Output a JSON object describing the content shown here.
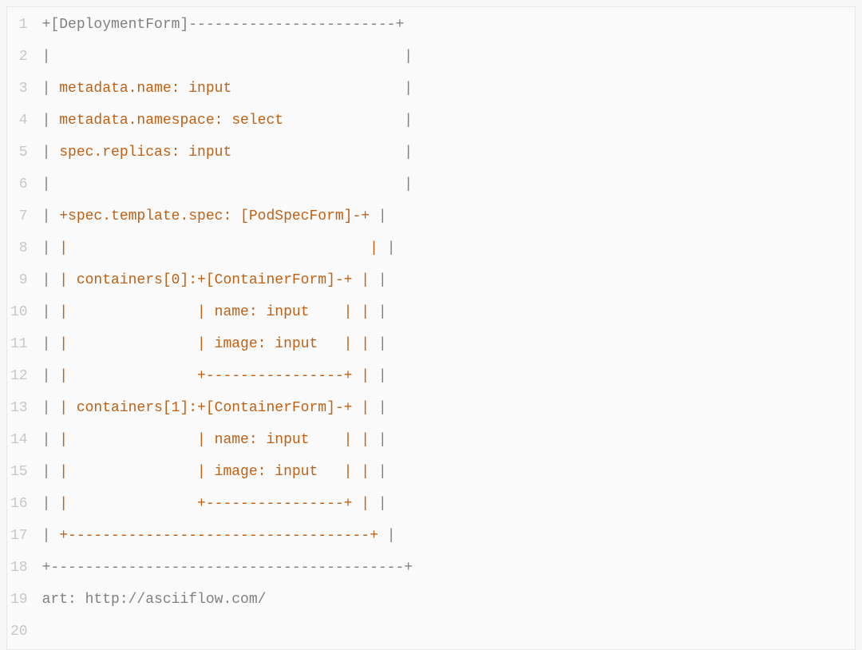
{
  "lines": [
    {
      "n": 1,
      "segments": [
        {
          "cls": "gray",
          "text": "+[DeploymentForm]------------------------+"
        }
      ]
    },
    {
      "n": 2,
      "segments": [
        {
          "cls": "gray",
          "text": "|                                         |"
        }
      ]
    },
    {
      "n": 3,
      "segments": [
        {
          "cls": "gray",
          "text": "| "
        },
        {
          "cls": "orange",
          "text": "metadata.name: input"
        },
        {
          "cls": "gray",
          "text": "                    |"
        }
      ]
    },
    {
      "n": 4,
      "segments": [
        {
          "cls": "gray",
          "text": "| "
        },
        {
          "cls": "orange",
          "text": "metadata.namespace: select"
        },
        {
          "cls": "gray",
          "text": "              |"
        }
      ]
    },
    {
      "n": 5,
      "segments": [
        {
          "cls": "gray",
          "text": "| "
        },
        {
          "cls": "orange",
          "text": "spec.replicas: input"
        },
        {
          "cls": "gray",
          "text": "                    |"
        }
      ]
    },
    {
      "n": 6,
      "segments": [
        {
          "cls": "gray",
          "text": "|                                         |"
        }
      ]
    },
    {
      "n": 7,
      "segments": [
        {
          "cls": "gray",
          "text": "| "
        },
        {
          "cls": "orange",
          "text": "+spec.template.spec: [PodSpecForm]-+"
        },
        {
          "cls": "gray",
          "text": " |"
        }
      ]
    },
    {
      "n": 8,
      "segments": [
        {
          "cls": "gray",
          "text": "| "
        },
        {
          "cls": "orange",
          "text": "|                                   |"
        },
        {
          "cls": "gray",
          "text": " |"
        }
      ]
    },
    {
      "n": 9,
      "segments": [
        {
          "cls": "gray",
          "text": "| "
        },
        {
          "cls": "orange",
          "text": "| containers[0]:+[ContainerForm]-+ |"
        },
        {
          "cls": "gray",
          "text": " |"
        }
      ]
    },
    {
      "n": 10,
      "segments": [
        {
          "cls": "gray",
          "text": "| "
        },
        {
          "cls": "orange",
          "text": "|               | name: input    | |"
        },
        {
          "cls": "gray",
          "text": " |"
        }
      ]
    },
    {
      "n": 11,
      "segments": [
        {
          "cls": "gray",
          "text": "| "
        },
        {
          "cls": "orange",
          "text": "|               | image: input   | |"
        },
        {
          "cls": "gray",
          "text": " |"
        }
      ]
    },
    {
      "n": 12,
      "segments": [
        {
          "cls": "gray",
          "text": "| "
        },
        {
          "cls": "orange",
          "text": "|               +----------------+ |"
        },
        {
          "cls": "gray",
          "text": " |"
        }
      ]
    },
    {
      "n": 13,
      "segments": [
        {
          "cls": "gray",
          "text": "| "
        },
        {
          "cls": "orange",
          "text": "| containers[1]:+[ContainerForm]-+ |"
        },
        {
          "cls": "gray",
          "text": " |"
        }
      ]
    },
    {
      "n": 14,
      "segments": [
        {
          "cls": "gray",
          "text": "| "
        },
        {
          "cls": "orange",
          "text": "|               | name: input    | |"
        },
        {
          "cls": "gray",
          "text": " |"
        }
      ]
    },
    {
      "n": 15,
      "segments": [
        {
          "cls": "gray",
          "text": "| "
        },
        {
          "cls": "orange",
          "text": "|               | image: input   | |"
        },
        {
          "cls": "gray",
          "text": " |"
        }
      ]
    },
    {
      "n": 16,
      "segments": [
        {
          "cls": "gray",
          "text": "| "
        },
        {
          "cls": "orange",
          "text": "|               +----------------+ |"
        },
        {
          "cls": "gray",
          "text": " |"
        }
      ]
    },
    {
      "n": 17,
      "segments": [
        {
          "cls": "gray",
          "text": "| "
        },
        {
          "cls": "orange",
          "text": "+-----------------------------------+"
        },
        {
          "cls": "gray",
          "text": " |"
        }
      ]
    },
    {
      "n": 18,
      "segments": [
        {
          "cls": "gray",
          "text": "+-----------------------------------------+"
        }
      ]
    },
    {
      "n": 19,
      "segments": [
        {
          "cls": "gray",
          "text": ""
        }
      ]
    },
    {
      "n": 20,
      "segments": [
        {
          "cls": "gray",
          "text": "art: http://asciiflow.com/"
        }
      ]
    }
  ]
}
